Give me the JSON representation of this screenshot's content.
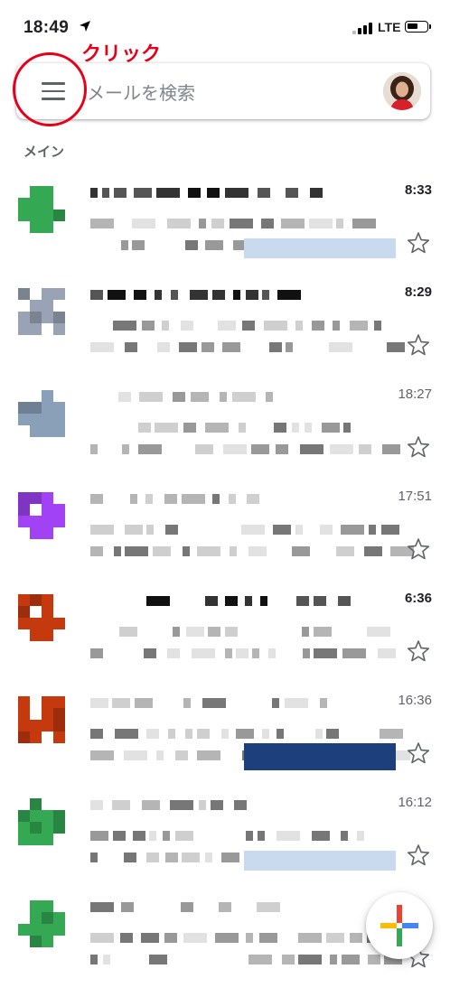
{
  "status_bar": {
    "time": "18:49",
    "network": "LTE"
  },
  "annotation": {
    "label": "クリック",
    "color": "#e8001a"
  },
  "search": {
    "placeholder": "メールを検索"
  },
  "section_label": "メイン",
  "mails": [
    {
      "time": "8:33",
      "unread": true,
      "avatar_color": "#34a853"
    },
    {
      "time": "8:29",
      "unread": true,
      "avatar_color": "#9aa3b5"
    },
    {
      "time": "18:27",
      "unread": false,
      "avatar_color": "#8aa0b8"
    },
    {
      "time": "17:51",
      "unread": false,
      "avatar_color": "#a142f4"
    },
    {
      "time": "6:36",
      "unread": true,
      "avatar_color": "#c5390f"
    },
    {
      "time": "16:36",
      "unread": false,
      "avatar_color": "#c5390f"
    },
    {
      "time": "16:12",
      "unread": false,
      "avatar_color": "#34a853"
    },
    {
      "time": "",
      "unread": false,
      "avatar_color": "#34a853"
    }
  ],
  "icons": {
    "menu": "hamburger-menu-icon",
    "star": "star-outline-icon",
    "compose": "compose-plus-icon"
  }
}
